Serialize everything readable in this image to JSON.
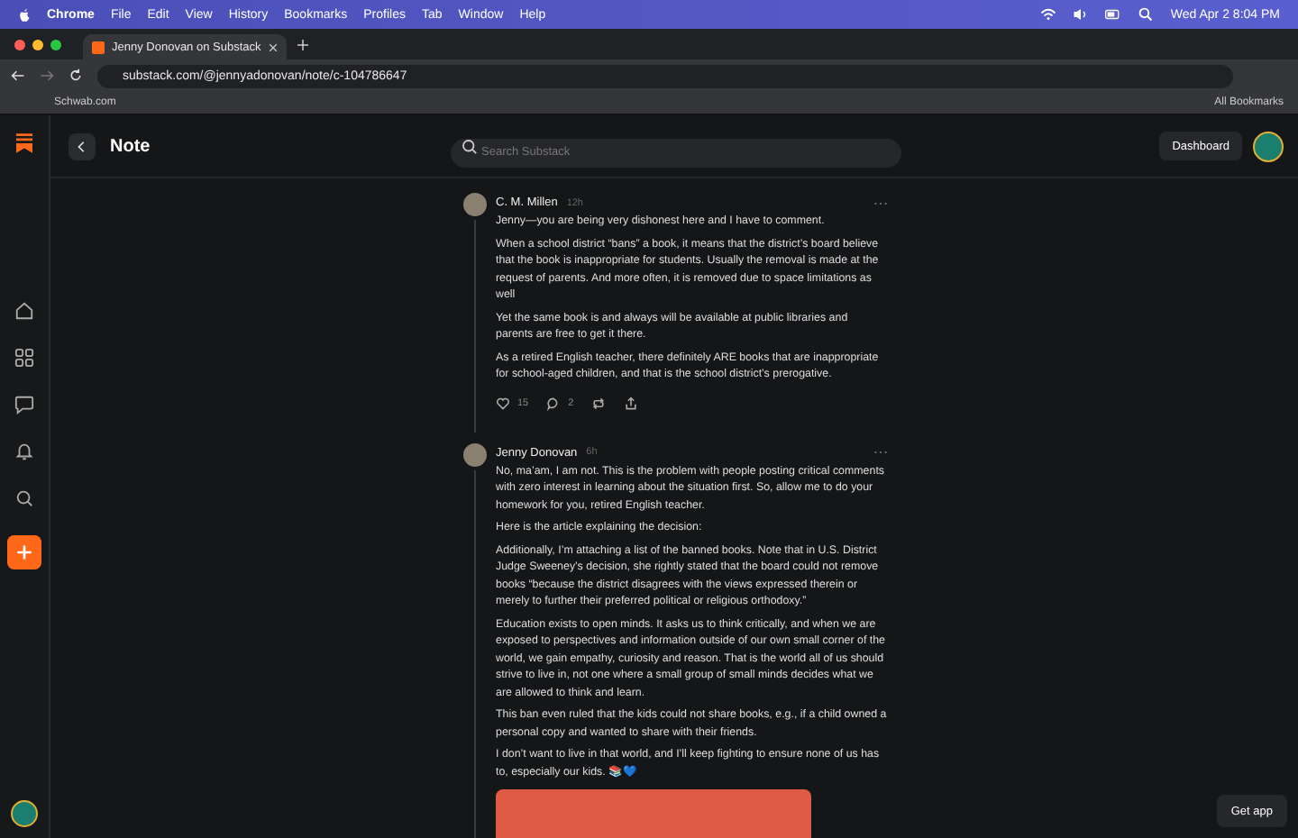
{
  "menubar": {
    "app": "Chrome",
    "items": [
      "File",
      "Edit",
      "View",
      "History",
      "Bookmarks",
      "Profiles",
      "Tab",
      "Window",
      "Help"
    ],
    "clock": "Wed Apr 2  8:04 PM"
  },
  "browser": {
    "tab_title": "Jenny Donovan on Substack",
    "url": "substack.com/@jennyadonovan/note/c-104786647",
    "bookmarks": [
      "Schwab.com"
    ],
    "all_bookmarks": "All Bookmarks"
  },
  "page": {
    "title": "Note",
    "search": {
      "placeholder": "Search Substack"
    },
    "dashboard": "Dashboard",
    "get_app": "Get app",
    "notes": [
      {
        "author": "C. M. Millen",
        "time": "12h",
        "paragraphs": [
          "Jenny—you are being very dishonest here and I have to comment.",
          "When a school district “bans” a book, it means that the district’s board believe that the book is inappropriate for students. Usually the removal is made at the request of parents. And more often, it is removed due to space limitations as well",
          "Yet the same book is and always will be available at public libraries and parents are free to get it there.",
          "As a retired English teacher, there definitely ARE books that are inappropriate for school-aged children, and that is the school district’s prerogative."
        ],
        "actions": {
          "likes": "15",
          "comments": "2"
        }
      },
      {
        "author": "Jenny Donovan",
        "time": "6h",
        "paragraphs": [
          "No, ma’am, I am not. This is the problem with people posting critical comments with zero interest in learning about the situation first. So, allow me to do your homework for you, retired English teacher.",
          "Here is the article explaining the decision:",
          "Additionally, I’m attaching a list of the banned books. Note that in U.S. District Judge Sweeney’s decision, she rightly stated that the board could not remove books “because the district disagrees with the views expressed therein or merely to further their preferred political or religious orthodoxy.”",
          "Education exists to open minds. It asks us to think critically, and when we are exposed to perspectives and information outside of our own small corner of the world, we gain empathy, curiosity and reason. That is the world all of us should strive to live in, not one where a small group of small minds decides what we are allowed to think and learn.",
          "This ban even ruled that the kids could not share books, e.g., if a child owned a personal copy and wanted to share with their friends.",
          "I don’t want to live in that world, and I’ll keep fighting to ensure none of us has to, especially our kids. 📚💙"
        ],
        "has_image": true
      }
    ]
  }
}
